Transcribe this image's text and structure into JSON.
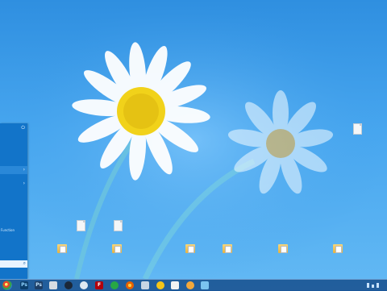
{
  "colors": {
    "panel": "#1274c9",
    "taskbar": "#164e8c"
  },
  "start_panel": {
    "header_icon": "power-icon",
    "rows": [
      {
        "label": "",
        "glyph": ""
      },
      {
        "label": "",
        "glyph": ""
      },
      {
        "label": "",
        "glyph": "›"
      },
      {
        "label": "",
        "glyph": "›"
      },
      {
        "label": "Function",
        "glyph": ""
      },
      {
        "label": "",
        "glyph": ""
      }
    ],
    "search_icon": "search-icon"
  },
  "desktop_icons": [
    {
      "label": "",
      "type": "file"
    },
    {
      "label": "",
      "type": "file"
    },
    {
      "label": "",
      "type": "file"
    },
    {
      "label": "",
      "type": "folder"
    },
    {
      "label": "",
      "type": "folder"
    },
    {
      "label": "",
      "type": "folder"
    },
    {
      "label": "",
      "type": "folder"
    },
    {
      "label": "",
      "type": "folder"
    },
    {
      "label": "",
      "type": "folder"
    }
  ],
  "taskbar": {
    "items": [
      {
        "icon": "chrome-icon",
        "glyph": ""
      },
      {
        "icon": "photoshop-icon",
        "glyph": "Ps"
      },
      {
        "icon": "photoshop-alt-icon",
        "glyph": "Ps"
      },
      {
        "icon": "explorer-icon",
        "glyph": ""
      },
      {
        "icon": "steam-icon",
        "glyph": ""
      },
      {
        "icon": "app-icon",
        "glyph": ""
      },
      {
        "icon": "filezilla-icon",
        "glyph": "F"
      },
      {
        "icon": "app-green-icon",
        "glyph": ""
      },
      {
        "icon": "firefox-icon",
        "glyph": ""
      },
      {
        "icon": "tool-icon",
        "glyph": ""
      },
      {
        "icon": "app-yellow-icon",
        "glyph": ""
      },
      {
        "icon": "notes-icon",
        "glyph": ""
      },
      {
        "icon": "user-icon",
        "glyph": ""
      },
      {
        "icon": "network-icon",
        "glyph": ""
      }
    ]
  }
}
